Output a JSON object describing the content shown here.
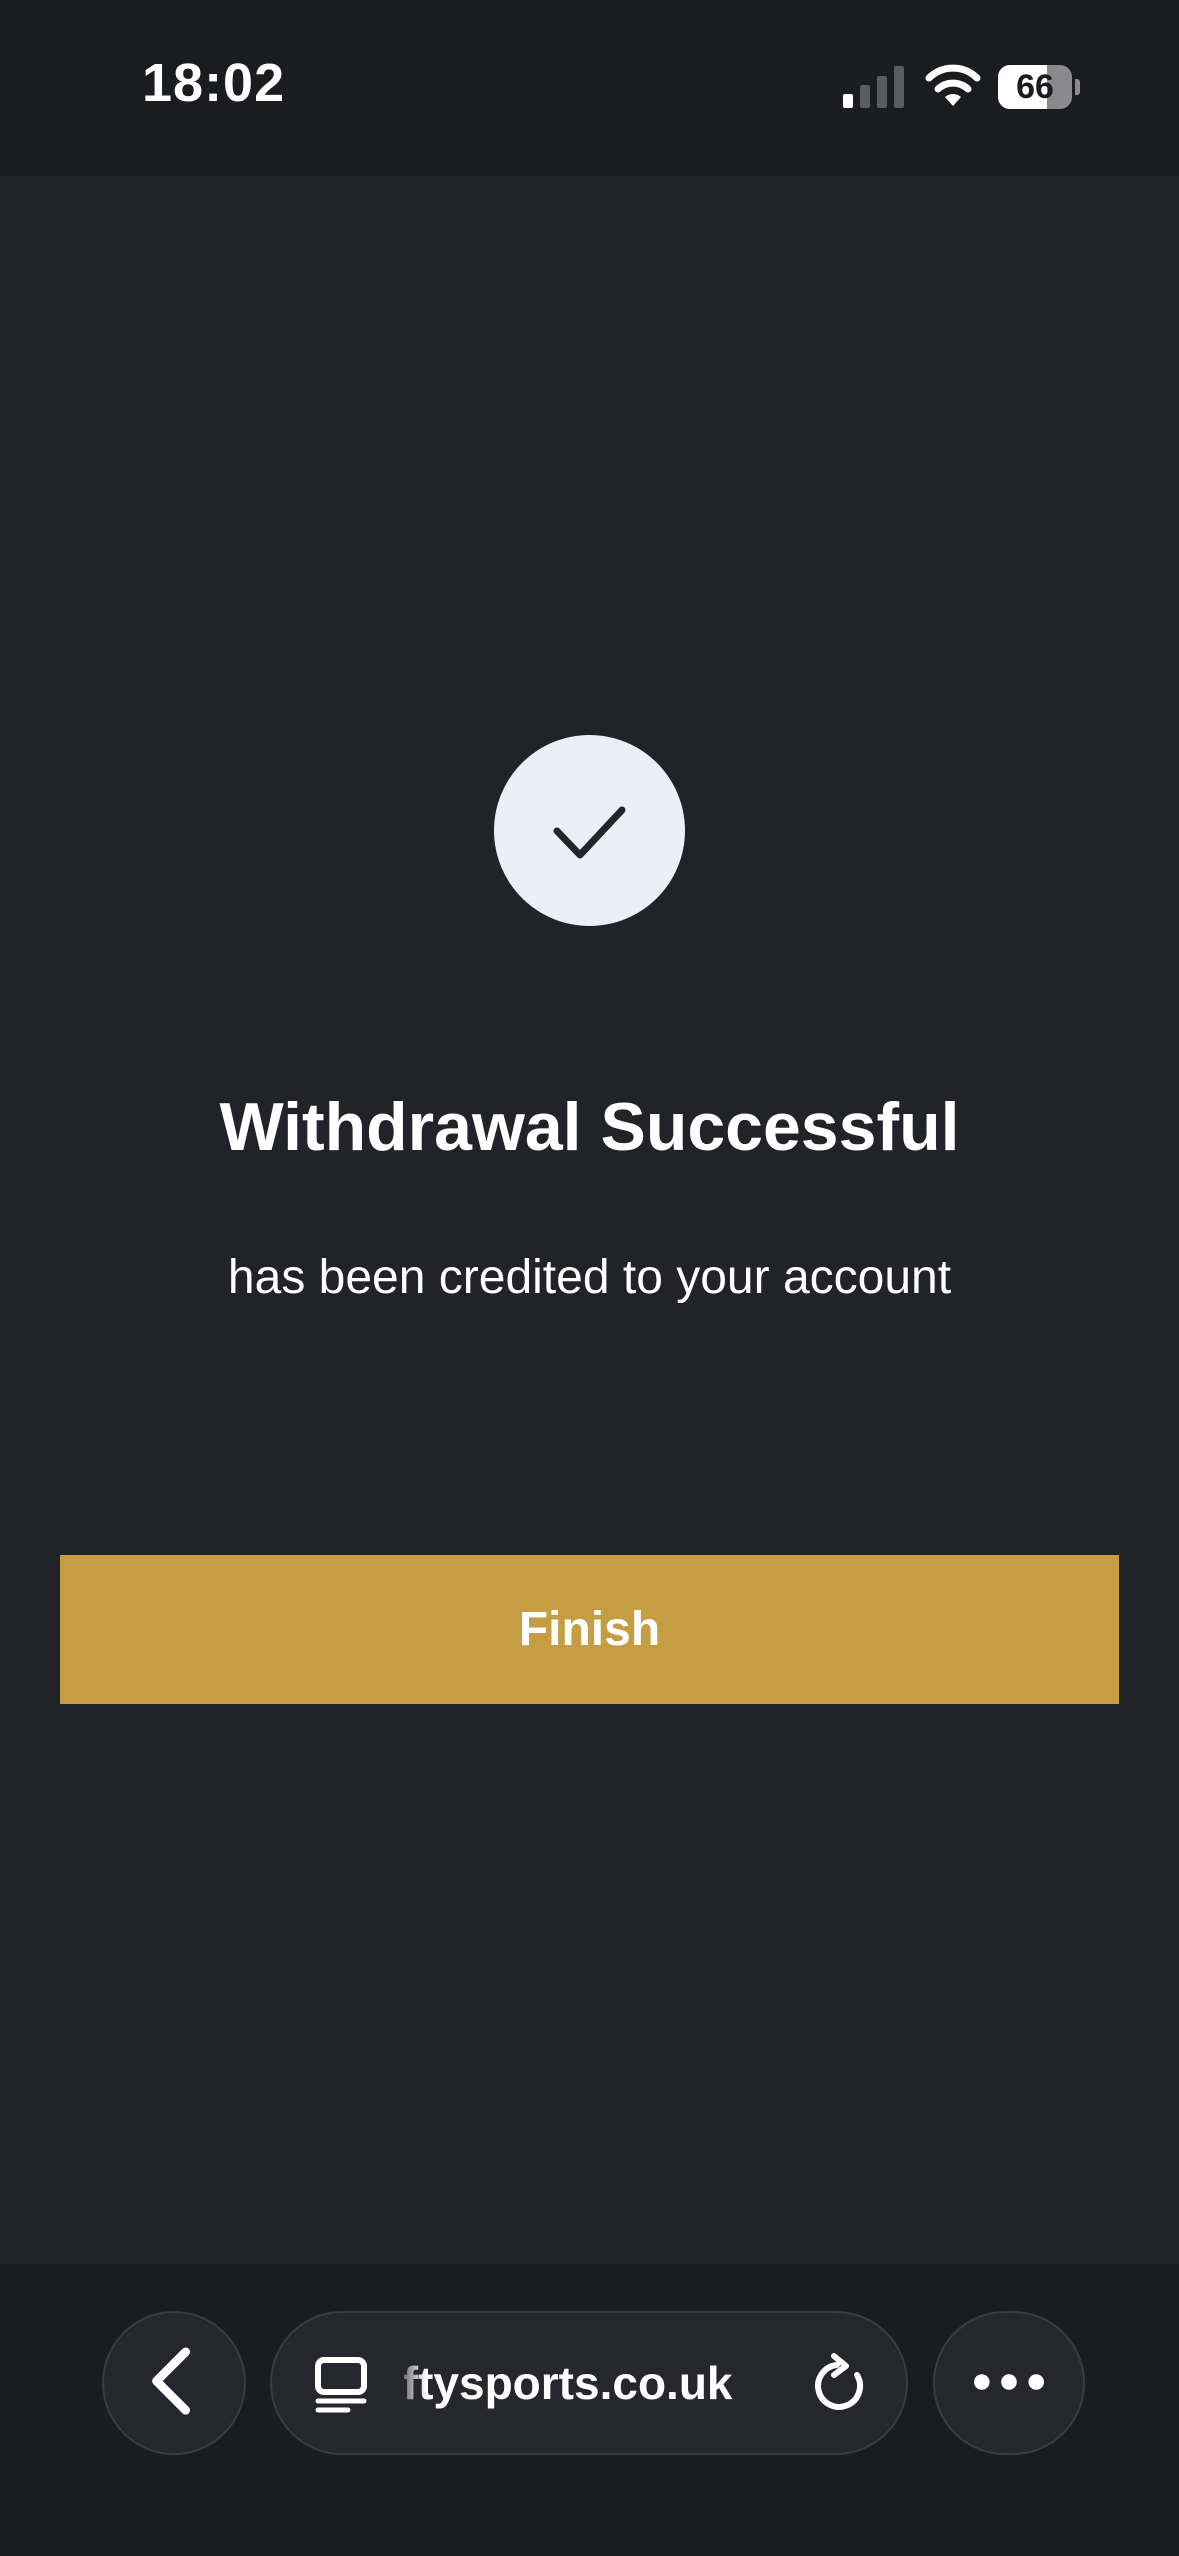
{
  "status_bar": {
    "time": "18:02",
    "battery_level": "66",
    "signal_icon": "cellular-signal-icon",
    "wifi_icon": "wifi-icon"
  },
  "main": {
    "status_icon": "checkmark-icon",
    "title": "Withdrawal Successful",
    "subtitle": "has been credited to your account",
    "finish_label": "Finish"
  },
  "browser_bar": {
    "back_icon": "chevron-left-icon",
    "tabs_icon": "tabs-icon",
    "url": "iftysports.co.uk",
    "reload_icon": "reload-icon",
    "more_icon": "more-icon"
  },
  "colors": {
    "background": "#212328",
    "accent": "#c59d43",
    "check_circle": "#eaeff8"
  }
}
